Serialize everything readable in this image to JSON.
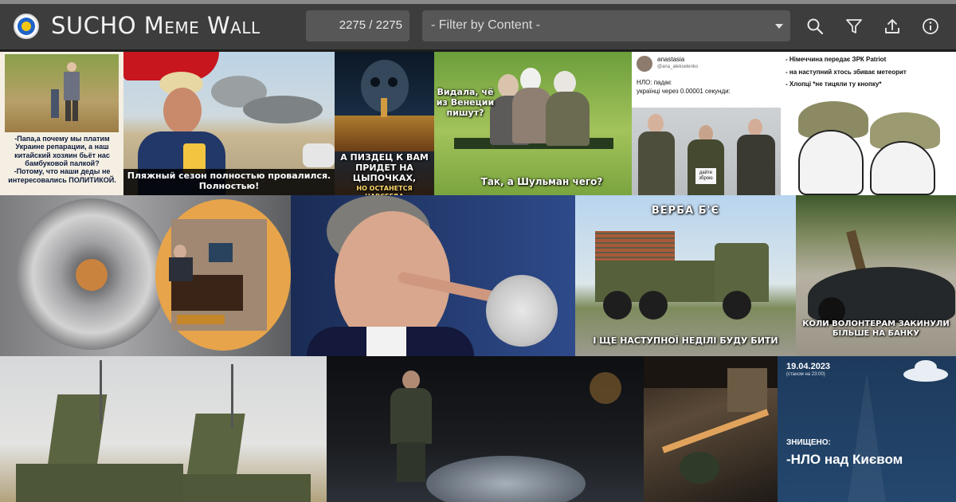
{
  "header": {
    "title": "SUCHO Meme Wall",
    "counter": "2275 / 2275",
    "filter_placeholder": "- Filter by Content -",
    "icons": [
      "search-icon",
      "filter-icon",
      "upload-icon",
      "info-icon"
    ],
    "logo": "sucho-logo"
  },
  "colors": {
    "header_bg": "#3d3d3d",
    "field_bg": "#575757",
    "text": "#f2f2f2"
  },
  "memes": [
    {
      "text": "-Папа,а почему мы платим Украине репарации, а наш китайский хозяин бьёт нас бамбуковой палкой?\n-Потому, что наши деды не интересовались ПОЛИТИКОЙ."
    },
    {
      "text": "Пляжный сезон полностью провалился.\nПолностью!"
    },
    {
      "text": "А ПИЗДЕЦ К ВАМ ПРИДЕТ НА ЦЫПОЧКАХ,",
      "text2": "НО ОСТАНЕТСЯ НАВСЕГДА"
    },
    {
      "text": "Видала, чё из Венеции пишут?",
      "text2": "Так, а Шульман чего?"
    },
    {
      "author": "anastasia",
      "handle": "@ana_alekselenko",
      "text": "НЛО: падає\nукраїнці через 0.00001 секунди:",
      "sign": "дайте зброю"
    },
    {
      "text": "- Німеччина передає ЗРК Patriot\n- на наступний хтось збиває метеорит\n- Хлопці *не тицяли ту кнопку*"
    },
    {
      "text": ""
    },
    {
      "text": ""
    },
    {
      "text": "ВЕРБА Б'Є",
      "text2": "І ЩЕ НАСТУПНОЇ НЕДІЛІ БУДУ БИТИ"
    },
    {
      "text": "КОЛИ ВОЛОНТЕРАМ ЗАКИНУЛИ БІЛЬШЕ НА БАНКУ"
    },
    {
      "text": ""
    },
    {
      "text": ""
    },
    {
      "text": ""
    },
    {
      "date": "19.04.2023",
      "date_note": "(станом на 23:00)",
      "label": "ЗНИЩЕНО:",
      "text": "-НЛО над Києвом"
    }
  ]
}
